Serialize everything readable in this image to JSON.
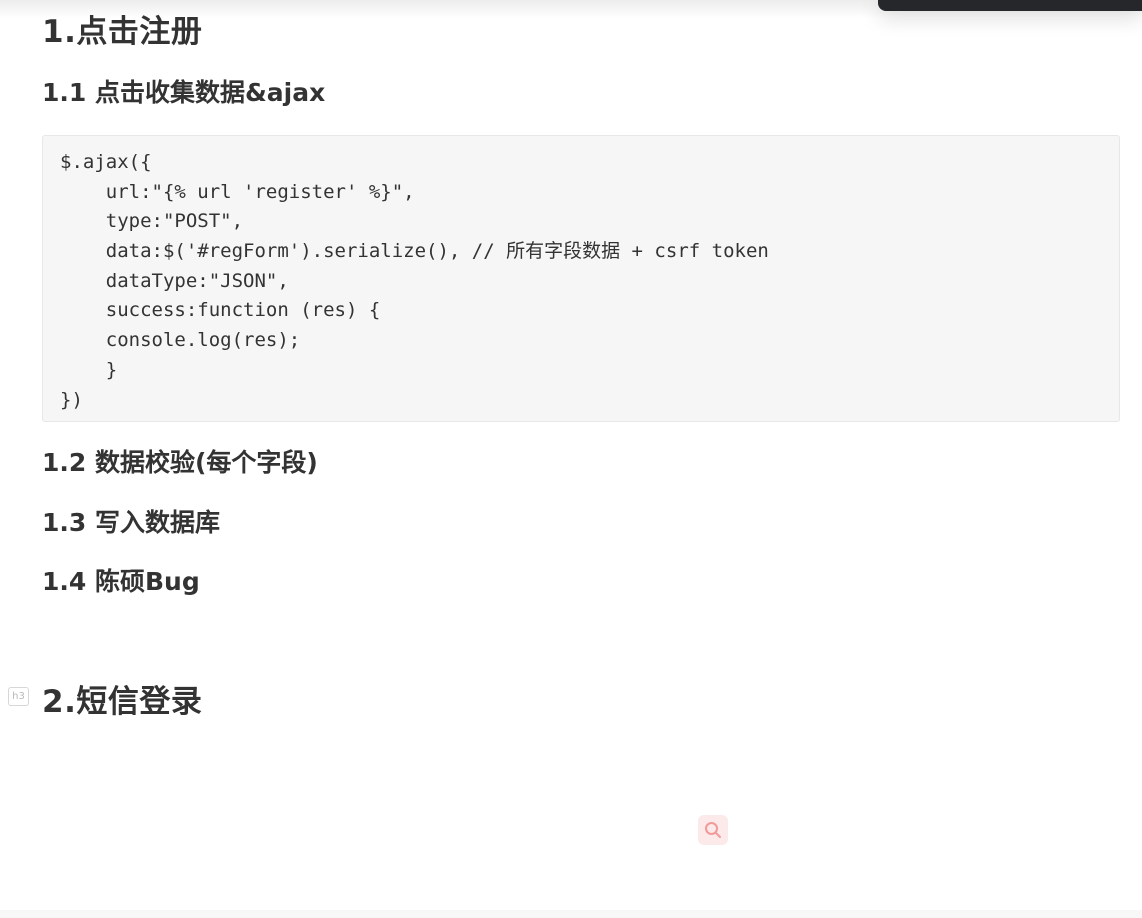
{
  "document": {
    "sections": [
      {
        "title": "1.点击注册"
      },
      {
        "title": "2.短信登录"
      }
    ],
    "subsections": [
      {
        "title": "1.1 点击收集数据&ajax"
      },
      {
        "title": "1.2 数据校验(每个字段)"
      },
      {
        "title": "1.3 写入数据库"
      },
      {
        "title": "1.4 陈硕Bug"
      }
    ],
    "code_block": {
      "lines": [
        "$.ajax({",
        "    url:\"{% url 'register' %}\",",
        "    type:\"POST\",",
        "    data:$('#regForm').serialize(), // 所有字段数据 + csrf token",
        "    dataType:\"JSON\",",
        "    success:function (res) {",
        "    console.log(res);",
        "    }",
        "})"
      ]
    },
    "heading_tag": "h3"
  },
  "floating_search": {
    "icon": "search-icon",
    "color": "#f19a9a"
  },
  "colors": {
    "text": "#333333",
    "code_background": "#f6f6f7",
    "code_border": "#e7e7e9",
    "top_bar": "#26272b"
  }
}
